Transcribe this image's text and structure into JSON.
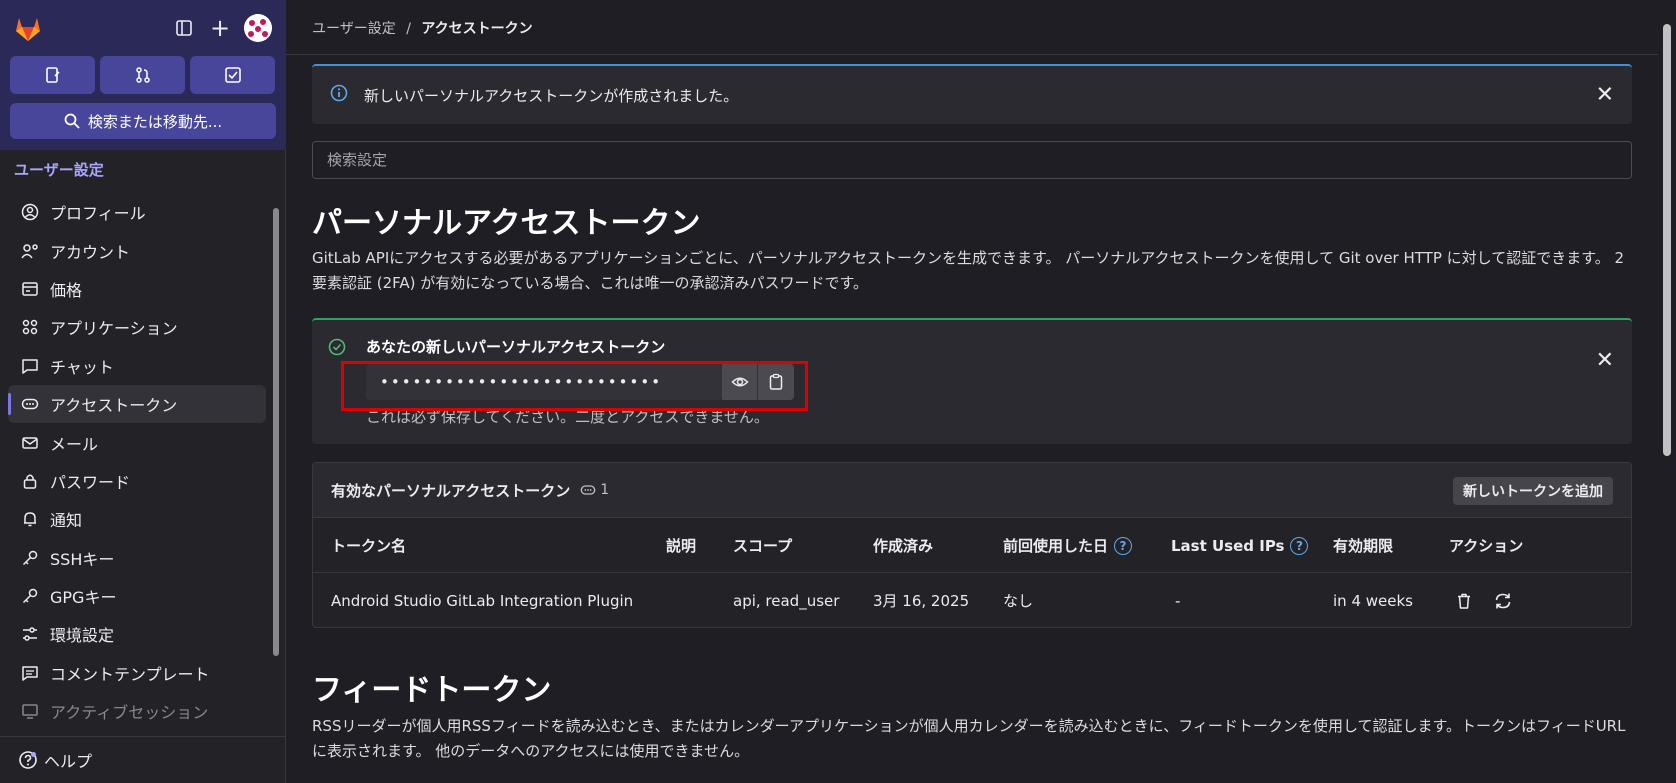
{
  "sidebar": {
    "search_label": "検索または移動先...",
    "section_title": "ユーザー設定",
    "items": [
      {
        "label": "プロフィール",
        "icon": "profile-icon"
      },
      {
        "label": "アカウント",
        "icon": "account-icon"
      },
      {
        "label": "価格",
        "icon": "billing-icon"
      },
      {
        "label": "アプリケーション",
        "icon": "applications-icon"
      },
      {
        "label": "チャット",
        "icon": "chat-icon"
      },
      {
        "label": "アクセストークン",
        "icon": "token-icon"
      },
      {
        "label": "メール",
        "icon": "mail-icon"
      },
      {
        "label": "パスワード",
        "icon": "lock-icon"
      },
      {
        "label": "通知",
        "icon": "bell-icon"
      },
      {
        "label": "SSHキー",
        "icon": "key-icon"
      },
      {
        "label": "GPGキー",
        "icon": "key-icon"
      },
      {
        "label": "環境設定",
        "icon": "preferences-icon"
      },
      {
        "label": "コメントテンプレート",
        "icon": "comment-icon"
      },
      {
        "label": "アクティブセッション",
        "icon": "monitor-icon"
      }
    ],
    "help_label": "ヘルプ"
  },
  "breadcrumb": {
    "parent": "ユーザー設定",
    "separator": "/",
    "current": "アクセストークン"
  },
  "info_alert": {
    "message": "新しいパーソナルアクセストークンが作成されました。"
  },
  "search_settings": {
    "placeholder": "検索設定"
  },
  "page": {
    "title": "パーソナルアクセストークン",
    "description": "GitLab APIにアクセスする必要があるアプリケーションごとに、パーソナルアクセストークンを生成できます。 パーソナルアクセストークンを使用して Git over HTTP に対して認証できます。 2要素認証 (2FA) が有効になっている場合、これは唯一の承認済みパスワードです。"
  },
  "new_token": {
    "heading": "あなたの新しいパーソナルアクセストークン",
    "masked_value": "••••••••••••••••••••••••••",
    "note": "これは必ず保存してください。二度とアクセスできません。"
  },
  "active_tokens": {
    "title": "有効なパーソナルアクセストークン",
    "count": "1",
    "add_button": "新しいトークンを追加",
    "columns": [
      "トークン名",
      "説明",
      "スコープ",
      "作成済み",
      "前回使用した日",
      "Last Used IPs",
      "有効期限",
      "アクション"
    ],
    "rows": [
      {
        "name": "Android Studio GitLab Integration Plugin",
        "description": "",
        "scopes": "api, read_user",
        "created": "3月 16, 2025",
        "last_used": "なし",
        "last_ips": "-",
        "expires": "in 4 weeks"
      }
    ]
  },
  "feed": {
    "title": "フィードトークン",
    "description": "RSSリーダーが個人用RSSフィードを読み込むとき、またはカレンダーアプリケーションが個人用カレンダーを読み込むときに、フィードトークンを使用して認証します。トークンはフィードURLに表示されます。 他のデータへのアクセスには使用できません。"
  },
  "colors": {
    "accent": "#a8a5ff",
    "info": "#428fdc",
    "success": "#2da160",
    "highlight": "#e00000"
  }
}
